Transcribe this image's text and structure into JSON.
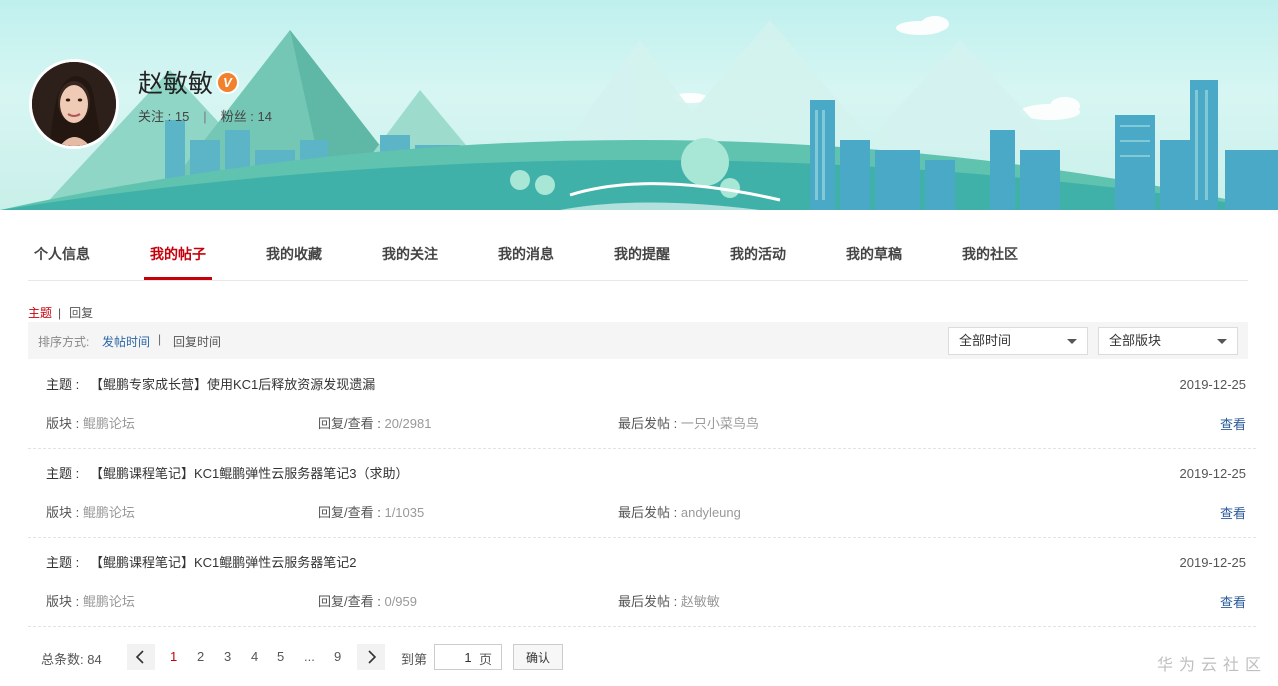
{
  "profile": {
    "name": "赵敏敏",
    "verified_badge": "V",
    "following_label": "关注 : 15",
    "separator": "|",
    "followers_label": "粉丝 : 14"
  },
  "tabs": [
    {
      "label": "个人信息",
      "active": false
    },
    {
      "label": "我的帖子",
      "active": true
    },
    {
      "label": "我的收藏",
      "active": false
    },
    {
      "label": "我的关注",
      "active": false
    },
    {
      "label": "我的消息",
      "active": false
    },
    {
      "label": "我的提醒",
      "active": false
    },
    {
      "label": "我的活动",
      "active": false
    },
    {
      "label": "我的草稿",
      "active": false
    },
    {
      "label": "我的社区",
      "active": false
    }
  ],
  "subswitch": {
    "topics": "主题",
    "separator": "|",
    "replies": "回复"
  },
  "sort": {
    "label": "排序方式:",
    "by_post_time": "发帖时间",
    "separator": "|",
    "by_reply_time": "回复时间",
    "time_filter": "全部时间",
    "board_filter": "全部版块"
  },
  "post_labels": {
    "topic": "主题 :",
    "board": "版块 :",
    "reply_view": "回复/查看 :",
    "last_post": "最后发帖 :",
    "view": "查看"
  },
  "posts": [
    {
      "title": "【鲲鹏专家成长营】使用KC1后释放资源发现遗漏",
      "date": "2019-12-25",
      "board": "鲲鹏论坛",
      "reply_view": "20/2981",
      "last_poster": "一只小菜鸟鸟"
    },
    {
      "title": "【鲲鹏课程笔记】KC1鲲鹏弹性云服务器笔记3（求助）",
      "date": "2019-12-25",
      "board": "鲲鹏论坛",
      "reply_view": "1/1035",
      "last_poster": "andyleung"
    },
    {
      "title": "【鲲鹏课程笔记】KC1鲲鹏弹性云服务器笔记2",
      "date": "2019-12-25",
      "board": "鲲鹏论坛",
      "reply_view": "0/959",
      "last_poster": "赵敏敏"
    }
  ],
  "pagination": {
    "total_label": "总条数:",
    "total": "84",
    "pages": [
      "1",
      "2",
      "3",
      "4",
      "5",
      "...",
      "9"
    ],
    "current": "1",
    "goto_label": "到第",
    "page_input": "1",
    "page_unit": "页",
    "confirm": "确认"
  },
  "watermark": "华为云社区",
  "colors": {
    "accent": "#c7000b",
    "link": "#2a66a8",
    "badge": "#f1812c"
  }
}
